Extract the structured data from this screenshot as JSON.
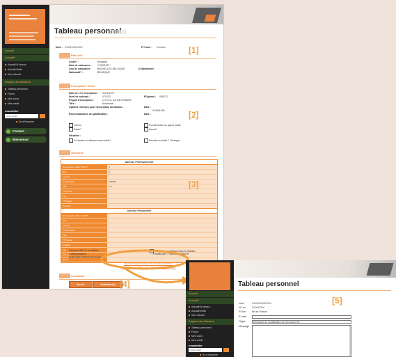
{
  "callouts": {
    "c1": "[1]",
    "c2": "[2]",
    "c3": "[3]",
    "c4": "[4]",
    "c5": "[5]"
  },
  "sidebar": {
    "sections": [
      "Accueil",
      "Actualit?",
      "Espace des titulaires"
    ],
    "actualite_items": [
      "Actualit?s?ances",
      "Actualit?mdfs",
      "Vers ddmdd"
    ],
    "titulaire_items": [
      "Tableau personnel",
      "Forum",
      "Mes cours",
      "Mes credit"
    ],
    "newsletter_label": "newsletter",
    "newsletter_placeholder": "votre email",
    "newsletter_link": "Se d?sinscrire",
    "contact": "Contact",
    "bienvenue": "Bienvenue"
  },
  "page1": {
    "title": "Tableau personnel",
    "title_ghost": "00000",
    "nom_label": "Nom :",
    "nom_value": "XXXXXXXXXXX",
    "prenom_label": "Pr?nom :",
    "prenom_value": "Xxxxxxx",
    "etat_civil_heading": "Etat civil",
    "etat_civil": [
      {
        "k": "Civilit? :",
        "v": "Monsieur"
      },
      {
        "k": "Date de naissance :",
        "v": "17/03/1927"
      },
      {
        "k": "Lieu de naissance :",
        "v": "BRUXELLES BELGIQUE"
      },
      {
        "k": "Nationalit? :",
        "v": "BELGIQUE"
      }
    ],
    "departement_label": "D?partement :",
    "inscription_heading": "Inscription / Ordre",
    "inscription": [
      {
        "k": "Date de 1?re inscription :",
        "v": "01/12/1977"
      },
      {
        "k": "Num?ro national :",
        "v": "071023"
      },
      {
        "k": "R?gion d'inscription :",
        "v": "C.R.O.A. ILE-DE-FRANCE"
      },
      {
        "k": "Titre :",
        "v": "Architecte"
      },
      {
        "k": "Options retenues pour l'inscription au tableau :",
        "v": ""
      },
      {
        "k": "Reconnaissance de qualification :",
        "v": ""
      }
    ],
    "regional_label": "R?gional :",
    "regional_value": "006272",
    "date_label": "Date :",
    "date_value": "01/06/1993",
    "checks_left": [
      "Lib?ral",
      "Salari?"
    ],
    "checks_right": [
      "Fonctionnaire ou agent public",
      "Associ?"
    ],
    "situation_label": "Situation :",
    "situation_left": "Pr?sentez au tableau mais activit?",
    "situation_right": "Decision exclusif ? l'?tranger",
    "adresses_heading": "Adresses",
    "pro_heading": "Adresse Professionnelle",
    "pro_rows": [
      "Nom agence / SEL Soci?t?",
      "Rue",
      "Lieu dit",
      "Code Postal",
      "Ville",
      "T?l?phone",
      "Fax",
      "T?l?copie",
      "Portable",
      "Site web"
    ],
    "pro_values": [
      "X",
      "X",
      "",
      "SAMEG",
      "X X",
      "",
      "",
      "",
      "",
      ""
    ],
    "perso_heading": "Adresse Personnelle",
    "perso_rows": [
      "Nom agence / SEL Soci?t?",
      "Rue",
      "Lieu dit",
      "Code Postal",
      "Ville",
      "T?l?phone",
      "Portable",
      "Fax",
      "Site web",
      "Email"
    ],
    "option_left_a": "Adresse affich?e au tableau",
    "option_left_b": "correspondance",
    "option_left_c": "ADRESSE PROFESSIONNELLE",
    "option_right": "Adresse aux publique avec la mention",
    "option_right_b": "\"n'habite pas ? l'adresse indiqu?e\"",
    "link_demande": "DEMANDE DE MODIFICATION DE MES DONN?ES",
    "link_demande_b": "DEMANDE DE CORRECTION / PR?CISIONS / ERREURS",
    "cotisation_heading": "Cotisation",
    "btn_annee": "Ann?e",
    "btn_cotisation": "Cotisation(s)",
    "cotisation_link": "Acc?der ? la cotisation"
  },
  "page2": {
    "title": "Tableau personnel",
    "rows": [
      {
        "k": "Nom",
        "v": "XXXXXXXXXXX"
      },
      {
        "k": "N? no.",
        "v": "XXXXXXX"
      },
      {
        "k": "R?ion",
        "v": "Ile de France"
      },
      {
        "k": "E-mail",
        "v": ""
      },
      {
        "k": "Objet",
        "v": "Demande de modification de mes donn?es"
      },
      {
        "k": "Message",
        "v": ""
      }
    ],
    "sidebar_sections": [
      "Accueil",
      "Actualit?",
      "Espace des titulaires"
    ],
    "actualite_items": [
      "Actualit?s?ances",
      "Actualit?mdfs",
      "Vers ddmdd"
    ],
    "titulaire_items": [
      "Tableau personnel",
      "Forum",
      "Mes cours",
      "Mes credit"
    ],
    "newsletter_label": "newsletter",
    "newsletter_placeholder": "votre email",
    "newsletter_link": "Se d?sinscrire"
  },
  "colors": {
    "accent": "#e8823c",
    "callout": "#f0a040",
    "sidebar": "#202020",
    "section": "#2d4623"
  }
}
